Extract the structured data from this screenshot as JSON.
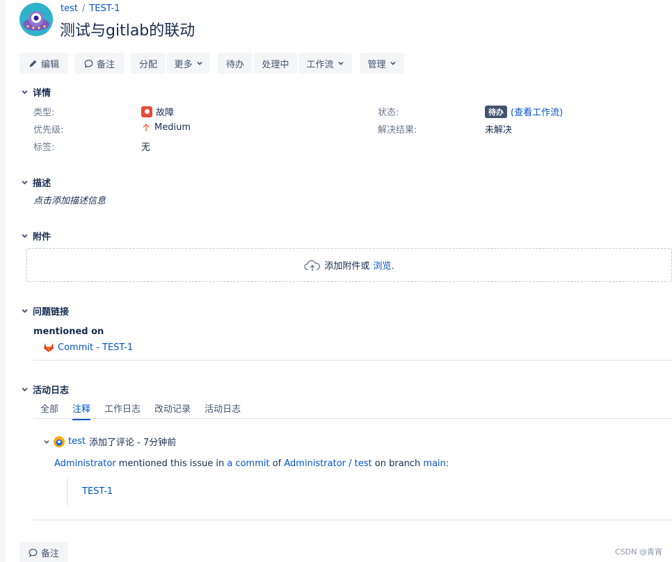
{
  "breadcrumb": {
    "project": "test",
    "separator": "/",
    "issue_key": "TEST-1"
  },
  "issue_title": "测试与gitlab的联动",
  "toolbar": {
    "edit": "编辑",
    "comment": "备注",
    "assign": "分配",
    "more": "更多",
    "todo": "待办",
    "in_progress": "处理中",
    "workflow": "工作流",
    "admin": "管理"
  },
  "details": {
    "heading": "详情",
    "type_label": "类型:",
    "type_value": "故障",
    "priority_label": "优先级:",
    "priority_value": "Medium",
    "labels_label": "标签:",
    "labels_value": "无",
    "status_label": "状态:",
    "status_value": "待办",
    "view_workflow": "(查看工作流)",
    "resolution_label": "解决结果:",
    "resolution_value": "未解决"
  },
  "description": {
    "heading": "描述",
    "placeholder": "点击添加描述信息"
  },
  "attachments": {
    "heading": "附件",
    "drop_text": "添加附件或",
    "browse": "浏览."
  },
  "issue_links": {
    "heading": "问题链接",
    "group": "mentioned on",
    "link_text": "Commit - TEST-1"
  },
  "activity": {
    "heading": "活动日志",
    "tabs": [
      "全部",
      "注释",
      "工作日志",
      "改动记录",
      "活动日志"
    ],
    "active_tab": 1,
    "comment": {
      "author": "test",
      "action": "添加了评论 - 7分钟前",
      "body_author": "Administrator",
      "body_text1": "mentioned this issue in",
      "body_link1": "a commit",
      "body_text2": "of",
      "body_link2": "Administrator / test",
      "body_text3": "on branch",
      "body_link3": "main",
      "body_text4": ":",
      "quote_link": "TEST-1"
    }
  },
  "bottom_comment_button": "备注",
  "watermark": "CSDN @青宵",
  "colors": {
    "link": "#0052cc",
    "bug": "#e5493a",
    "priority": "#ff7452",
    "status_badge": "#42526e"
  }
}
